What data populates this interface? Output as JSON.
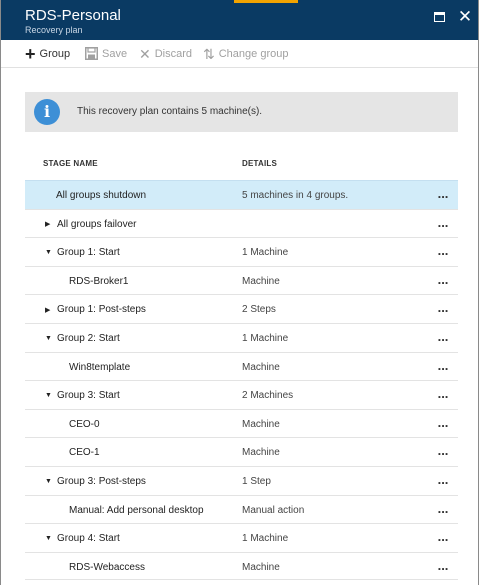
{
  "window": {
    "title": "RDS-Personal",
    "subtitle": "Recovery plan",
    "maximize_icon": "maximize-icon",
    "close_icon": "close-icon",
    "title_bar_color": "#0a3a63",
    "accent_color": "#f2a300"
  },
  "toolbar": {
    "group_label": "Group",
    "save_label": "Save",
    "discard_label": "Discard",
    "change_group_label": "Change group"
  },
  "info": {
    "message": "This recovery plan contains 5 machine(s)."
  },
  "table": {
    "columns": {
      "stage": "STAGE NAME",
      "details": "DETAILS"
    },
    "rows": [
      {
        "stage": "All groups shutdown",
        "details": "5 machines in 4 groups.",
        "caret": "",
        "level": 0,
        "selected": true
      },
      {
        "stage": "All groups failover",
        "details": "",
        "caret": "right",
        "level": 1
      },
      {
        "stage": "Group 1: Start",
        "details": "1 Machine",
        "caret": "down",
        "level": 1
      },
      {
        "stage": "RDS-Broker1",
        "details": "Machine",
        "caret": "",
        "level": 2
      },
      {
        "stage": "Group 1: Post-steps",
        "details": "2 Steps",
        "caret": "right",
        "level": 1
      },
      {
        "stage": "Group 2: Start",
        "details": "1 Machine",
        "caret": "down",
        "level": 1
      },
      {
        "stage": "Win8template",
        "details": "Machine",
        "caret": "",
        "level": 2
      },
      {
        "stage": "Group 3: Start",
        "details": "2 Machines",
        "caret": "down",
        "level": 1
      },
      {
        "stage": "CEO-0",
        "details": "Machine",
        "caret": "",
        "level": 2
      },
      {
        "stage": "CEO-1",
        "details": "Machine",
        "caret": "",
        "level": 2
      },
      {
        "stage": "Group 3: Post-steps",
        "details": "1 Step",
        "caret": "down",
        "level": 1
      },
      {
        "stage": "Manual: Add personal desktop",
        "details": "Manual action",
        "caret": "",
        "level": 2
      },
      {
        "stage": "Group 4: Start",
        "details": "1 Machine",
        "caret": "down",
        "level": 1
      },
      {
        "stage": "RDS-Webaccess",
        "details": "Machine",
        "caret": "",
        "level": 2
      }
    ],
    "more_label": "..."
  }
}
